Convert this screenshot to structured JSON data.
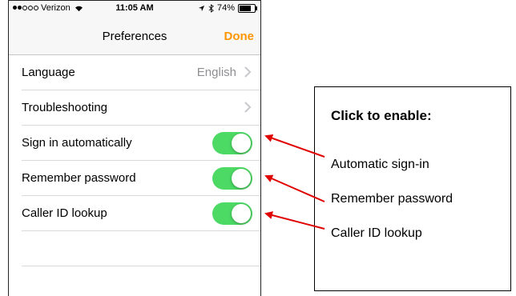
{
  "status_bar": {
    "carrier": "Verizon",
    "time": "11:05 AM",
    "battery": "74%"
  },
  "nav": {
    "title": "Preferences",
    "done_label": "Done"
  },
  "settings": {
    "language": {
      "label": "Language",
      "value": "English"
    },
    "troubleshooting": {
      "label": "Troubleshooting"
    },
    "sign_in_automatically": {
      "label": "Sign in automatically",
      "enabled": true
    },
    "remember_password": {
      "label": "Remember password",
      "enabled": true
    },
    "caller_id_lookup": {
      "label": "Caller ID lookup",
      "enabled": true
    }
  },
  "callout": {
    "title": "Click to enable:",
    "items": [
      "Automatic sign-in",
      "Remember password",
      "Caller ID lookup"
    ]
  },
  "colors": {
    "toggle_on": "#4cd964",
    "done_accent": "#ff9500",
    "arrow": "#e00000"
  }
}
